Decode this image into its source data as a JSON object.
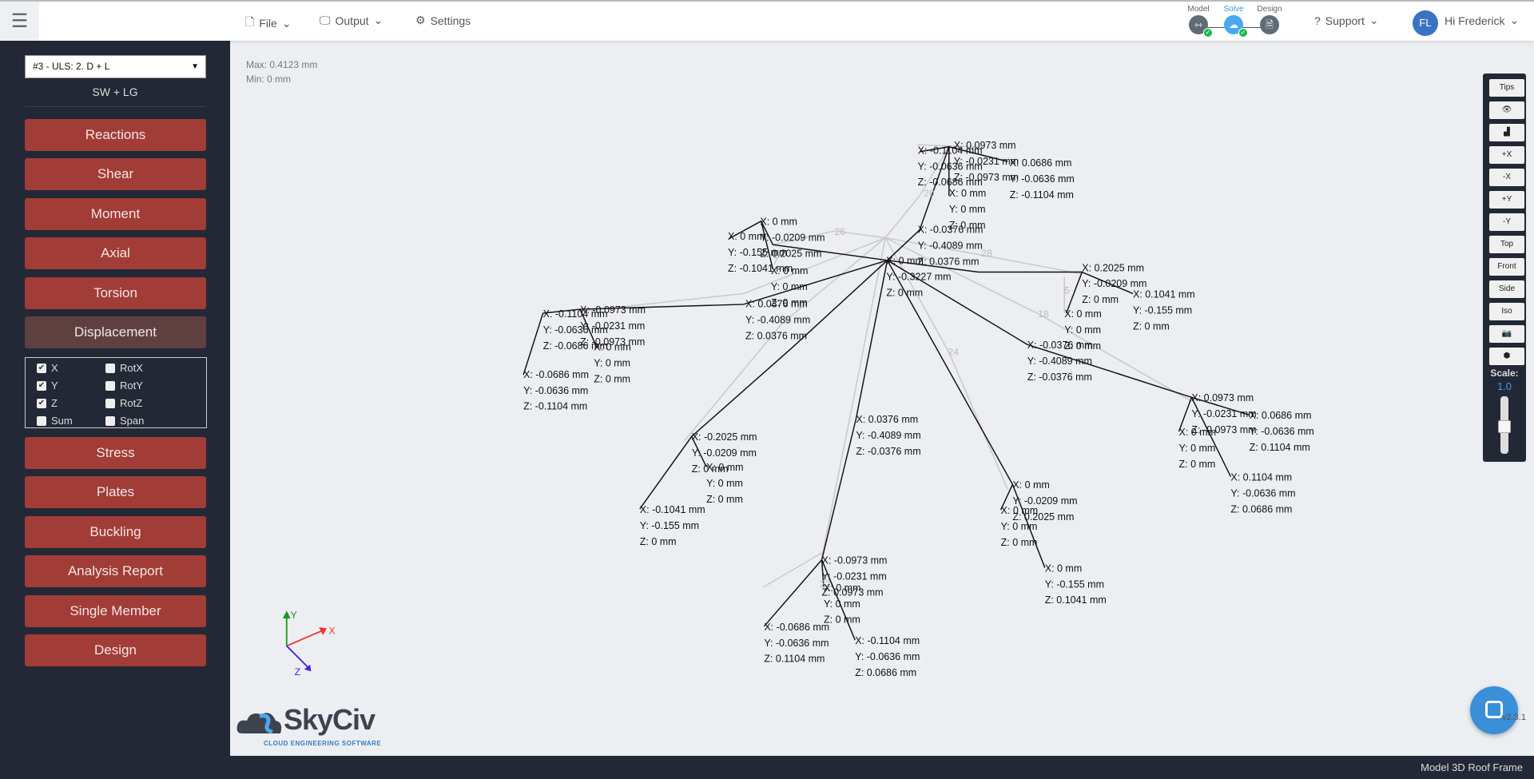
{
  "header": {
    "file": "File",
    "output": "Output",
    "settings": "Settings",
    "steps": [
      {
        "label": "Model"
      },
      {
        "label": "Solve"
      },
      {
        "label": "Design"
      }
    ],
    "support": "Support",
    "user_initials": "FL",
    "user_greeting": "Hi Frederick"
  },
  "sidebar": {
    "load_combo": "#3 - ULS: 2. D + L",
    "load_combo_sub": "SW + LG",
    "buttons": [
      "Reactions",
      "Shear",
      "Moment",
      "Axial",
      "Torsion",
      "Displacement",
      "Stress",
      "Plates",
      "Buckling",
      "Analysis Report",
      "Single Member",
      "Design"
    ],
    "active": "Displacement",
    "checkboxes": [
      {
        "label": "X",
        "checked": true
      },
      {
        "label": "RotX",
        "checked": false
      },
      {
        "label": "Y",
        "checked": true
      },
      {
        "label": "RotY",
        "checked": false
      },
      {
        "label": "Z",
        "checked": true
      },
      {
        "label": "RotZ",
        "checked": false
      },
      {
        "label": "Sum",
        "checked": false
      },
      {
        "label": "Span",
        "checked": false
      }
    ]
  },
  "viewport": {
    "max": "Max: 0.4123 mm",
    "min": "Min: 0 mm",
    "labels": [
      [
        "X: -0.1104 mm",
        "Y: -0.0636 mm",
        "Z: -0.0686 mm"
      ],
      [
        "X: -0.0973 mm",
        "Y: -0.0231 mm",
        "Z: -0.0973 mm"
      ],
      [
        "X: 0 mm",
        "Y: 0 mm",
        "Z: 0 mm"
      ],
      [
        "X: -0.0686 mm",
        "Y: -0.0636 mm",
        "Z: -0.1104 mm"
      ],
      [
        "X: 0 mm",
        "Y: -0.0209 mm",
        "Z: 0.2025 mm"
      ],
      [
        "X: 0 mm",
        "Y: -0.155 mm",
        "Z: -0.1041 mm"
      ],
      [
        "X: 0 mm",
        "Y: 0 mm",
        "Z: 0 mm"
      ],
      [
        "X: 0.0376 mm",
        "Y: -0.4089 mm",
        "Z: 0.0376 mm"
      ],
      [
        "X: 0 mm",
        "Y: -0.3227 mm",
        "Z: 0 mm"
      ],
      [
        "X: -0.0376 mm",
        "Y: -0.4089 mm",
        "Z: 0.0376 mm"
      ],
      [
        "X: -0.1104 mm",
        "Y: -0.0636 mm",
        "Z: -0.0686 mm"
      ],
      [
        "X: 0.0973 mm",
        "Y: -0.0231 mm",
        "Z: -0.0973 mm"
      ],
      [
        "X: 0.0686 mm",
        "Y: -0.0636 mm",
        "Z: -0.1104 mm"
      ],
      [
        "X: 0 mm",
        "Y: 0 mm",
        "Z: 0 mm"
      ],
      [
        "X: 0.2025 mm",
        "Y: -0.0209 mm",
        "Z: 0 mm"
      ],
      [
        "X: 0.1041 mm",
        "Y: -0.155 mm",
        "Z: 0 mm"
      ],
      [
        "X: 0 mm",
        "Y: 0 mm",
        "Z: 0 mm"
      ],
      [
        "X: -0.0376 mm",
        "Y: -0.4089 mm",
        "Z: -0.0376 mm"
      ],
      [
        "X: 0.0973 mm",
        "Y: -0.0231 mm",
        "Z: -0.0973 mm"
      ],
      [
        "X: 0.0686 mm",
        "Y: -0.0636 mm",
        "Z: 0.1104 mm"
      ],
      [
        "X: 0 mm",
        "Y: 0 mm",
        "Z: 0 mm"
      ],
      [
        "X: 0.1104 mm",
        "Y: -0.0636 mm",
        "Z: 0.0686 mm"
      ],
      [
        "X: 0.0376 mm",
        "Y: -0.4089 mm",
        "Z: -0.0376 mm"
      ],
      [
        "X: -0.2025 mm",
        "Y: -0.0209 mm",
        "Z: 0 mm"
      ],
      [
        "X: 0 mm",
        "Y: 0 mm",
        "Z: 0 mm"
      ],
      [
        "X: -0.1041 mm",
        "Y: -0.155 mm",
        "Z: 0 mm"
      ],
      [
        "X: 0 mm",
        "Y: -0.0209 mm",
        "Z: 0.2025 mm"
      ],
      [
        "X: 0 mm",
        "Y: 0 mm",
        "Z: 0 mm"
      ],
      [
        "X: 0 mm",
        "Y: -0.155 mm",
        "Z: 0.1041 mm"
      ],
      [
        "X: -0.0973 mm",
        "Y: -0.0231 mm",
        "Z: 0.0973 mm"
      ],
      [
        "X: 0 mm",
        "Y: 0 mm",
        "Z: 0 mm"
      ],
      [
        "X: -0.0686 mm",
        "Y: -0.0636 mm",
        "Z: 0.1104 mm"
      ],
      [
        "X: -0.1104 mm",
        "Y: -0.0636 mm",
        "Z: 0.0686 mm"
      ]
    ],
    "member_labels": [
      "26",
      "28",
      "18",
      "24",
      "20",
      "22",
      "5",
      "7"
    ],
    "axes": [
      "Y",
      "X",
      "Z"
    ]
  },
  "toolbar": {
    "tips": "Tips",
    "view_icon": "eye-icon",
    "chart_icon": "area-chart-icon",
    "buttons": [
      "+X",
      "-X",
      "+Y",
      "-Y",
      "Top",
      "Front",
      "Side",
      "Iso"
    ],
    "camera_icon": "camera-icon",
    "cube_icon": "cube-icon",
    "scale_label": "Scale:",
    "scale_value": "1.0"
  },
  "logo": {
    "name": "SkyCiv",
    "tagline": "CLOUD ENGINEERING SOFTWARE"
  },
  "version": "v2.3.1",
  "footer": "Model 3D Roof Frame",
  "colors": {
    "sidebar": "#232836",
    "button": "#a13c37",
    "accent": "#3a73c2"
  }
}
